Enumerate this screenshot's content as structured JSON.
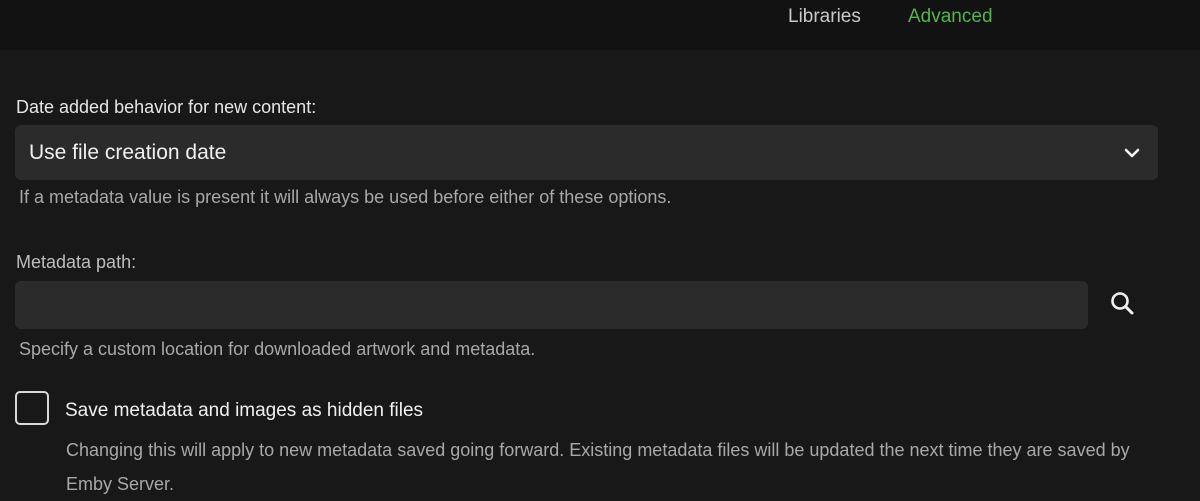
{
  "tabs": [
    {
      "label": "Libraries",
      "active": false
    },
    {
      "label": "Advanced",
      "active": true
    }
  ],
  "date_added": {
    "label": "Date added behavior for new content:",
    "selected": "Use file creation date",
    "help": "If a metadata value is present it will always be used before either of these options.",
    "icon": "chevron-down-icon"
  },
  "metadata_path": {
    "label": "Metadata path:",
    "value": "",
    "placeholder": "",
    "help": "Specify a custom location for downloaded artwork and metadata.",
    "icon": "search-icon"
  },
  "hidden_files": {
    "label": "Save metadata and images as hidden files",
    "checked": false,
    "help": "Changing this will apply to new metadata saved going forward. Existing metadata files will be updated the next time they are saved by Emby Server."
  },
  "colors": {
    "background": "#181818",
    "topbar": "#121212",
    "accent": "#52b54b",
    "field": "#2b2b2b"
  }
}
